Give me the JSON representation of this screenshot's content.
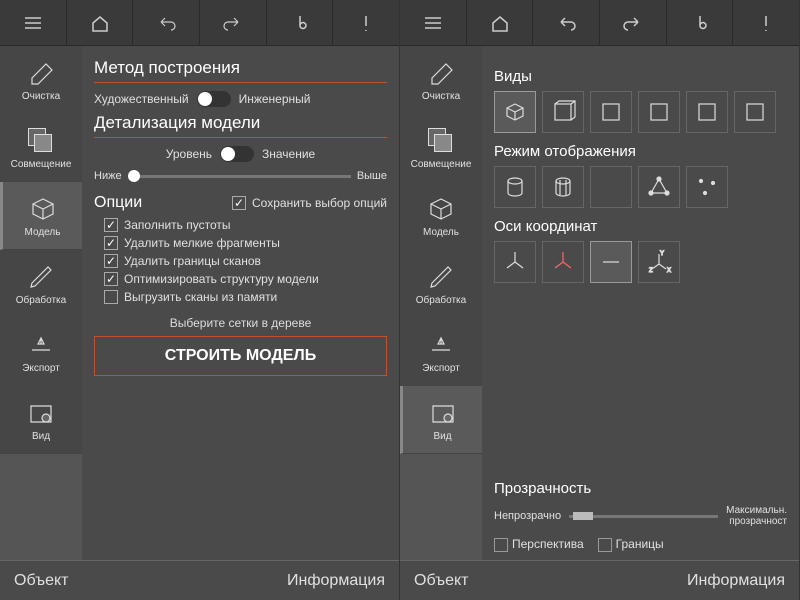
{
  "topbar_icons": [
    "menu",
    "home",
    "undo",
    "redo",
    "thermo",
    "alert"
  ],
  "sidebar": [
    {
      "name": "clean",
      "label": "Очистка"
    },
    {
      "name": "align",
      "label": "Совмещение"
    },
    {
      "name": "model",
      "label": "Модель"
    },
    {
      "name": "process",
      "label": "Обработка"
    },
    {
      "name": "export",
      "label": "Экспорт"
    },
    {
      "name": "view",
      "label": "Вид"
    }
  ],
  "left": {
    "section1": "Метод построения",
    "mode_a": "Художественный",
    "mode_b": "Инженерный",
    "section2": "Детализация модели",
    "detail_a": "Уровень",
    "detail_b": "Значение",
    "slider_lo": "Ниже",
    "slider_hi": "Выше",
    "options": "Опции",
    "save_opts": "Сохранить выбор опций",
    "opts": [
      "Заполнить пустоты",
      "Удалить мелкие фрагменты",
      "Удалить границы сканов",
      "Оптимизировать структуру модели",
      "Выгрузить сканы из памяти"
    ],
    "opts_on": [
      true,
      true,
      true,
      true,
      false
    ],
    "hint": "Выберите сетки в дереве",
    "build": "СТРОИТЬ МОДЕЛЬ"
  },
  "right": {
    "views": "Виды",
    "display": "Режим отображения",
    "axes": "Оси координат",
    "transparency": "Прозрачность",
    "t_lo": "Непрозрачно",
    "t_hi": "Максимальн.\nпрозрачност",
    "perspective": "Перспектива",
    "bounds": "Границы"
  },
  "footer": {
    "l": "Объект",
    "r": "Информация"
  }
}
